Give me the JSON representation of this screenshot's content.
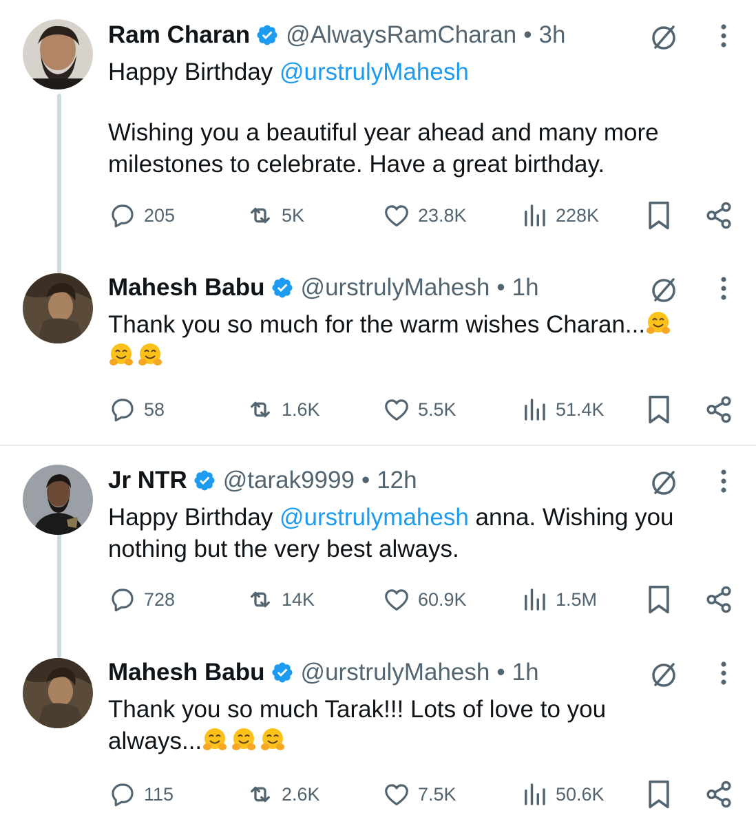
{
  "tweets": [
    {
      "name": "Ram Charan",
      "handle": "@AlwaysRamCharan",
      "sep": "•",
      "time": "3h",
      "text_prefix": "Happy Birthday ",
      "mention": "@urstrulyMahesh",
      "text_para": "Wishing you a beautiful year ahead and many more milestones to celebrate. Have a great birthday.",
      "replies": "205",
      "reposts": "5K",
      "likes": "23.8K",
      "views": "228K"
    },
    {
      "name": "Mahesh Babu",
      "handle": "@urstrulyMahesh",
      "sep": "•",
      "time": "1h",
      "text_line1": "Thank you so much for the warm wishes Charan...",
      "emoji_name": "hugging-face-emoji",
      "replies": "58",
      "reposts": "1.6K",
      "likes": "5.5K",
      "views": "51.4K"
    },
    {
      "name": "Jr NTR",
      "handle": "@tarak9999",
      "sep": "•",
      "time": "12h",
      "text_prefix": "Happy Birthday ",
      "mention": "@urstrulymahesh",
      "text_suffix": " anna. Wishing you nothing but the very best always.",
      "replies": "728",
      "reposts": "14K",
      "likes": "60.9K",
      "views": "1.5M"
    },
    {
      "name": "Mahesh Babu",
      "handle": "@urstrulyMahesh",
      "sep": "•",
      "time": "1h",
      "text_line1": "Thank you so much Tarak!!! Lots of love to you",
      "text_line2": "always...",
      "emoji_name": "hugging-face-emoji",
      "replies": "115",
      "reposts": "2.6K",
      "likes": "7.5K",
      "views": "50.6K"
    }
  ],
  "colors": {
    "text": "#0f1419",
    "secondary": "#536471",
    "link": "#1d9bf0",
    "verified": "#1d9bf0",
    "thread_line": "#cfd9de"
  }
}
